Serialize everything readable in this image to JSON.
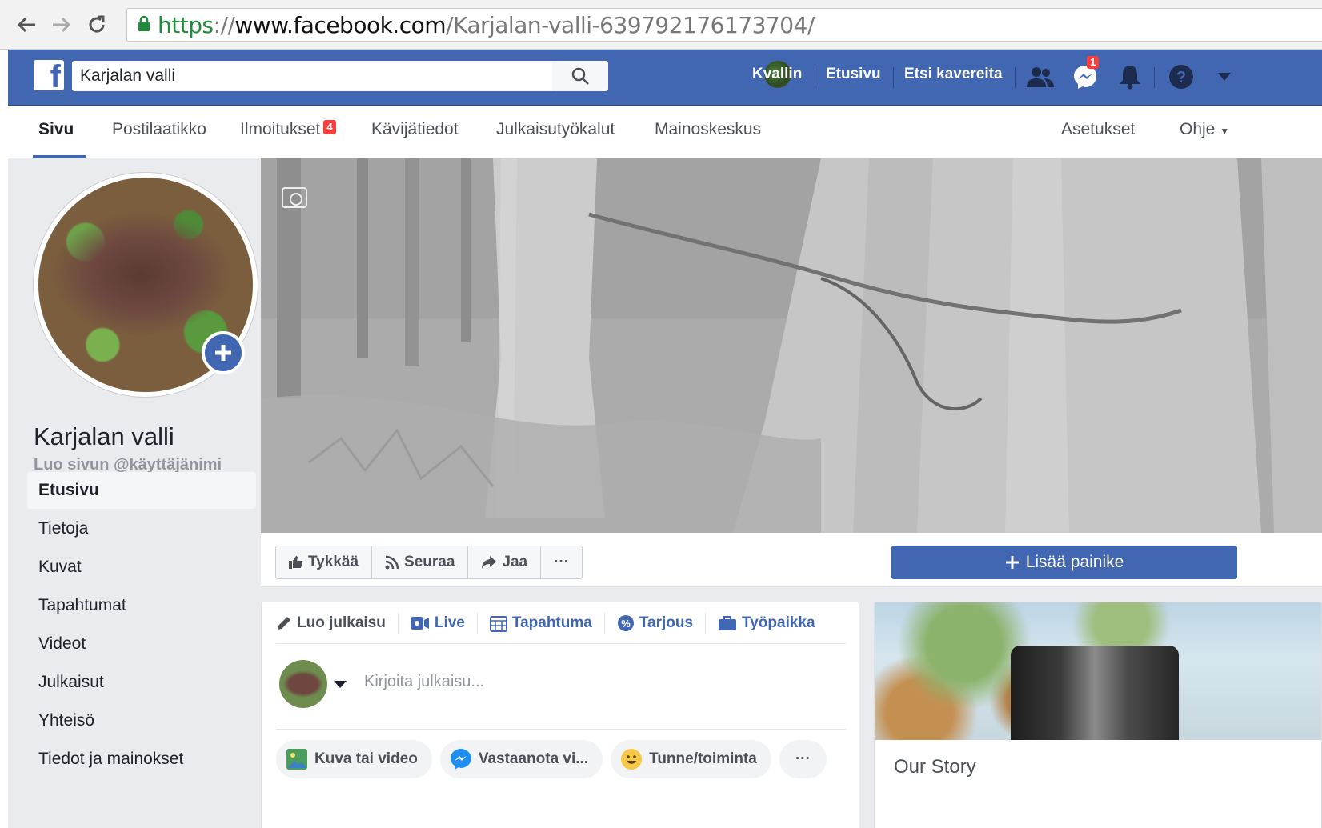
{
  "browser": {
    "url_scheme": "https",
    "url_sep": "://",
    "url_host": "www.facebook.com",
    "url_path": "/Karjalan-valli-639792176173704/"
  },
  "topbar": {
    "logo": "f",
    "search_value": "Karjalan valli",
    "user_name": "Kvallin",
    "home": "Etusivu",
    "find_friends": "Etsi kavereita",
    "messages_badge": "1",
    "accent_color": "#4267b2"
  },
  "tabs": [
    {
      "label": "Sivu"
    },
    {
      "label": "Postilaatikko"
    },
    {
      "label": "Ilmoitukset",
      "badge": "4"
    },
    {
      "label": "Kävijätiedot"
    },
    {
      "label": "Julkaisutyökalut"
    },
    {
      "label": "Mainoskeskus"
    },
    {
      "label": "Asetukset"
    },
    {
      "label": "Ohje"
    }
  ],
  "page": {
    "name": "Karjalan valli",
    "username_prompt": "Luo sivun @käyttäjänimi"
  },
  "sidebar": {
    "items": [
      {
        "label": "Etusivu"
      },
      {
        "label": "Tietoja"
      },
      {
        "label": "Kuvat"
      },
      {
        "label": "Tapahtumat"
      },
      {
        "label": "Videot"
      },
      {
        "label": "Julkaisut"
      },
      {
        "label": "Yhteisö"
      },
      {
        "label": "Tiedot ja mainokset"
      }
    ]
  },
  "actions": {
    "like": "Tykkää",
    "follow": "Seuraa",
    "share": "Jaa",
    "more": "···",
    "add_button": "Lisää painike"
  },
  "composer": {
    "tabs": [
      "Luo julkaisu",
      "Live",
      "Tapahtuma",
      "Tarjous",
      "Työpaikka"
    ],
    "placeholder": "Kirjoita julkaisu...",
    "actions": [
      "Kuva tai video",
      "Vastaanota vi...",
      "Tunne/toiminta",
      "···"
    ]
  },
  "story": {
    "title": "Our Story"
  }
}
